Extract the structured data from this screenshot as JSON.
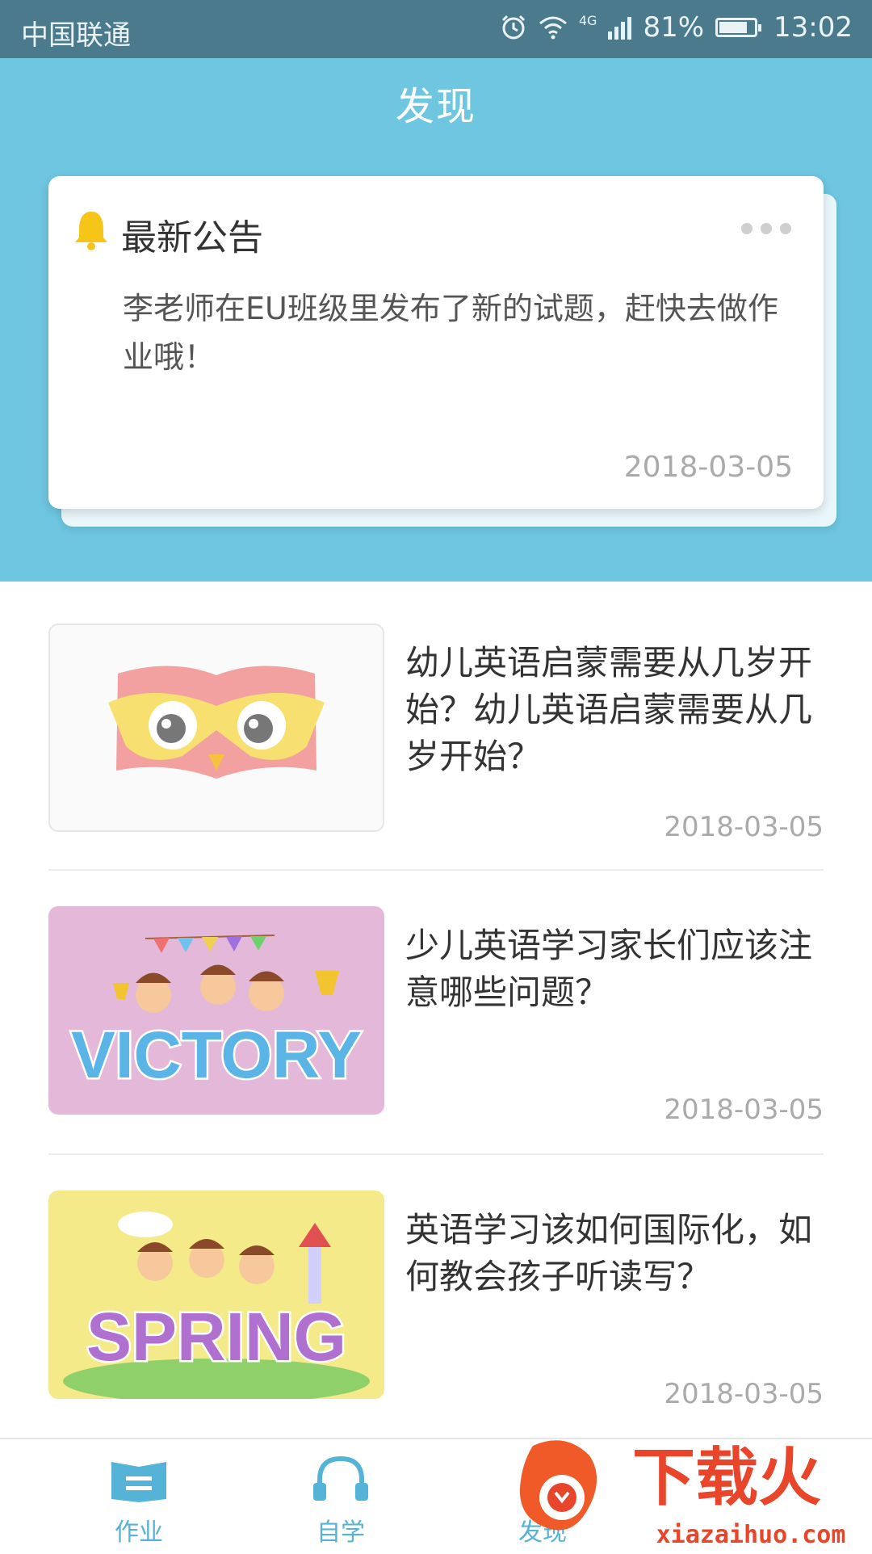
{
  "status_bar": {
    "carrier": "中国联通",
    "network": "4G",
    "battery": "81%",
    "battery_level": 0.81,
    "time": "13:02"
  },
  "header": {
    "title": "发现"
  },
  "notice": {
    "title": "最新公告",
    "body": "李老师在EU班级里发布了新的试题，赶快去做作业哦！",
    "date": "2018-03-05"
  },
  "articles": [
    {
      "title": "幼儿英语启蒙需要从几岁开始？幼儿英语启蒙需要从几岁开始？",
      "date": "2018-03-05",
      "image": "owl-logo"
    },
    {
      "title": "少儿英语学习家长们应该注意哪些问题？",
      "date": "2018-03-05",
      "image": "victory-illustration",
      "image_text": "VICTORY"
    },
    {
      "title": "英语学习该如何国际化，如何教会孩子听读写？",
      "date": "2018-03-05",
      "image": "spring-illustration",
      "image_text": "SPRING"
    }
  ],
  "bottom_nav": {
    "items": [
      {
        "label": "作业",
        "icon": "book-icon"
      },
      {
        "label": "自学",
        "icon": "headphones-icon"
      },
      {
        "label": "发现",
        "icon": "discover-icon"
      }
    ],
    "accent": "#54b3d6"
  },
  "watermark": {
    "brand": "下载火",
    "url": "xiazaihuo.com"
  },
  "colors": {
    "header_bg": "#6ec6e0",
    "status_bg": "#4a7a8c",
    "accent": "#54b3d6"
  }
}
